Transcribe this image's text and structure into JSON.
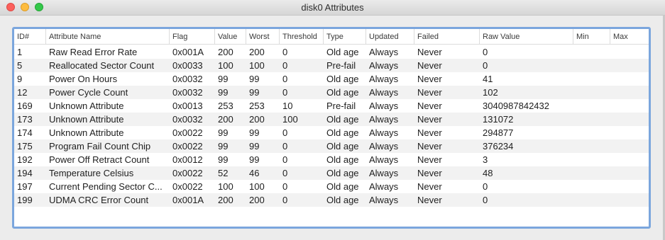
{
  "window": {
    "title": "disk0 Attributes"
  },
  "columns": {
    "id": "ID#",
    "name": "Attribute Name",
    "flag": "Flag",
    "value": "Value",
    "worst": "Worst",
    "threshold": "Threshold",
    "type": "Type",
    "updated": "Updated",
    "failed": "Failed",
    "raw": "Raw Value",
    "min": "Min",
    "max": "Max"
  },
  "rows": [
    {
      "id": "1",
      "name": "Raw Read Error Rate",
      "flag": "0x001A",
      "value": "200",
      "worst": "200",
      "threshold": "0",
      "type": "Old age",
      "updated": "Always",
      "failed": "Never",
      "raw": "0"
    },
    {
      "id": "5",
      "name": "Reallocated Sector Count",
      "flag": "0x0033",
      "value": "100",
      "worst": "100",
      "threshold": "0",
      "type": "Pre-fail",
      "updated": "Always",
      "failed": "Never",
      "raw": "0"
    },
    {
      "id": "9",
      "name": "Power On Hours",
      "flag": "0x0032",
      "value": "99",
      "worst": "99",
      "threshold": "0",
      "type": "Old age",
      "updated": "Always",
      "failed": "Never",
      "raw": "41"
    },
    {
      "id": "12",
      "name": "Power Cycle Count",
      "flag": "0x0032",
      "value": "99",
      "worst": "99",
      "threshold": "0",
      "type": "Old age",
      "updated": "Always",
      "failed": "Never",
      "raw": "102"
    },
    {
      "id": "169",
      "name": "Unknown Attribute",
      "flag": "0x0013",
      "value": "253",
      "worst": "253",
      "threshold": "10",
      "type": "Pre-fail",
      "updated": "Always",
      "failed": "Never",
      "raw": "3040987842432"
    },
    {
      "id": "173",
      "name": "Unknown Attribute",
      "flag": "0x0032",
      "value": "200",
      "worst": "200",
      "threshold": "100",
      "type": "Old age",
      "updated": "Always",
      "failed": "Never",
      "raw": "131072"
    },
    {
      "id": "174",
      "name": "Unknown Attribute",
      "flag": "0x0022",
      "value": "99",
      "worst": "99",
      "threshold": "0",
      "type": "Old age",
      "updated": "Always",
      "failed": "Never",
      "raw": "294877"
    },
    {
      "id": "175",
      "name": "Program Fail Count Chip",
      "flag": "0x0022",
      "value": "99",
      "worst": "99",
      "threshold": "0",
      "type": "Old age",
      "updated": "Always",
      "failed": "Never",
      "raw": "376234"
    },
    {
      "id": "192",
      "name": "Power Off Retract Count",
      "flag": "0x0012",
      "value": "99",
      "worst": "99",
      "threshold": "0",
      "type": "Old age",
      "updated": "Always",
      "failed": "Never",
      "raw": "3"
    },
    {
      "id": "194",
      "name": "Temperature Celsius",
      "flag": "0x0022",
      "value": "52",
      "worst": "46",
      "threshold": "0",
      "type": "Old age",
      "updated": "Always",
      "failed": "Never",
      "raw": "48"
    },
    {
      "id": "197",
      "name": "Current Pending Sector C...",
      "flag": "0x0022",
      "value": "100",
      "worst": "100",
      "threshold": "0",
      "type": "Old age",
      "updated": "Always",
      "failed": "Never",
      "raw": "0"
    },
    {
      "id": "199",
      "name": "UDMA CRC Error Count",
      "flag": "0x001A",
      "value": "200",
      "worst": "200",
      "threshold": "0",
      "type": "Old age",
      "updated": "Always",
      "failed": "Never",
      "raw": "0"
    }
  ]
}
